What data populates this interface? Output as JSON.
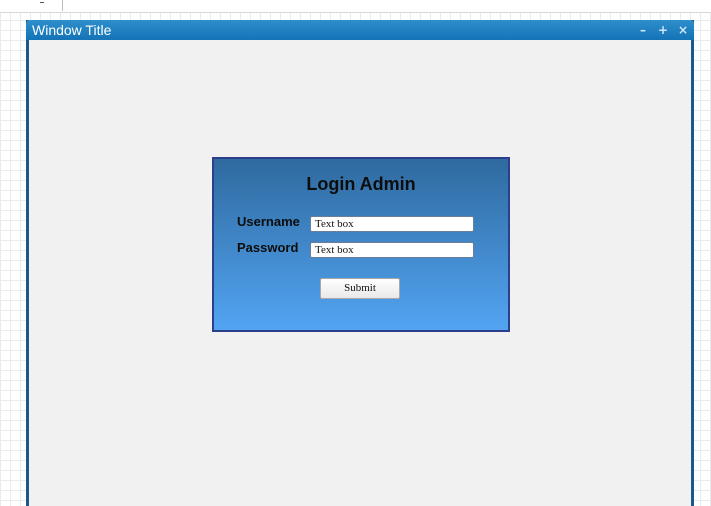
{
  "window": {
    "title": "Window Title",
    "controls": {
      "minimize": "–",
      "maximize": "+",
      "close": "×"
    }
  },
  "login": {
    "heading": "Login Admin",
    "username_label": "Username",
    "password_label": "Password",
    "username_value": "Text box",
    "password_value": "Text box",
    "submit_label": "Submit"
  },
  "colors": {
    "titlebar": "#1473b6",
    "window_border": "#1b5a86",
    "panel_top": "#2f6a9f",
    "panel_bottom": "#52a4f2",
    "panel_border": "#2b3f8a",
    "content_bg": "#f1f1f1"
  }
}
